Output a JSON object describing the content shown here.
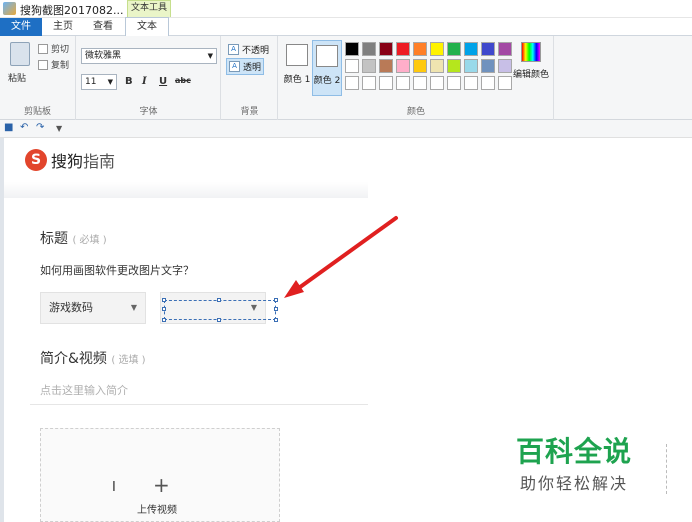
{
  "window": {
    "doc_title": "搜狗截图2017082...",
    "context_tab": "文本工具"
  },
  "tabs": {
    "file": "文件",
    "home": "主页",
    "view": "查看",
    "text": "文本"
  },
  "ribbon": {
    "clipboard": {
      "paste": "粘贴",
      "cut": "剪切",
      "copy": "复制",
      "group_label": "剪贴板"
    },
    "font": {
      "family": "微软雅黑",
      "size": "11",
      "bold": "B",
      "italic": "I",
      "underline": "U",
      "strike": "abc",
      "group_label": "字体"
    },
    "background": {
      "opaque": "不透明",
      "transparent": "透明",
      "group_label": "背景"
    },
    "colors": {
      "color1": "颜色 1",
      "color2": "颜色 2",
      "edit": "编辑颜色",
      "group_label": "颜色",
      "palette": [
        "#000000",
        "#7f7f7f",
        "#880015",
        "#ed1c24",
        "#ff7f27",
        "#fff200",
        "#22b14c",
        "#00a2e8",
        "#3f48cc",
        "#a349a4",
        "#ffffff",
        "#c3c3c3",
        "#b97a57",
        "#ffaec9",
        "#ffc90e",
        "#efe4b0",
        "#b5e61d",
        "#99d9ea",
        "#7092be",
        "#c8bfe7",
        "#ffffff",
        "#ffffff",
        "#ffffff",
        "#ffffff",
        "#ffffff",
        "#ffffff",
        "#ffffff",
        "#ffffff",
        "#ffffff",
        "#ffffff"
      ]
    }
  },
  "qat": {
    "save_icon": "save-icon",
    "undo_icon": "undo-icon",
    "redo_icon": "redo-icon"
  },
  "page": {
    "brand_logo": "S",
    "brand_name": "搜狗",
    "brand_sub": "指南",
    "title_label": "标题",
    "title_hint": "( 必填 )",
    "question": "如何用画图软件更改图片文字？",
    "category": "游戏数码",
    "intro_label": "简介&视频",
    "intro_hint": "( 选填 )",
    "intro_placeholder": "点击这里输入简介",
    "upload_plus": "+",
    "upload_label": "上传视频"
  },
  "watermark": {
    "main": "百科全说",
    "sub": "助你轻松解决"
  },
  "colors": {
    "accent": "#1e6fc4",
    "arrow": "#e02020",
    "watermark": "#1ea34f"
  }
}
